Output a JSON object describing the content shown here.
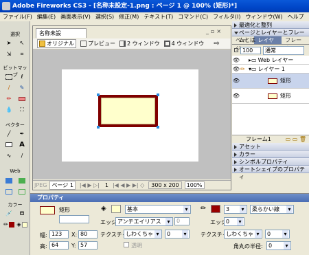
{
  "window": {
    "title": "Adobe Fireworks CS3 - [名称未設定-1.png : ページ 1 @ 100% (矩形)*]"
  },
  "menu": [
    "ファイル(F)",
    "編集(E)",
    "画面表示(V)",
    "選択(S)",
    "修正(M)",
    "テキスト(T)",
    "コマンド(C)",
    "フィルタ(I)",
    "ウィンドウ(W)",
    "ヘルプ(H)"
  ],
  "tools": {
    "select": "選択",
    "bitmap": "ビットマップ",
    "vector": "ベクター",
    "web": "Web",
    "colors": "カラー"
  },
  "document": {
    "tab": "名称未設定-1.png*",
    "views": [
      "オリジナル",
      "プレビュー",
      "2 ウィンドウ",
      "4 ウィンドウ"
    ],
    "status": {
      "format": "JPEG",
      "page": "ページ 1",
      "frame": "1",
      "size": "300 x 200",
      "zoom": "100%"
    }
  },
  "panels": {
    "align": "最適化と整列",
    "pages": "ページとレイヤーとフレームとは",
    "tabs": [
      "ページ",
      "レイヤー",
      "フレーム"
    ],
    "opacity": "100",
    "blend": "通常",
    "layers": [
      {
        "name": "Web レイヤー"
      },
      {
        "name": "レイヤー 1"
      },
      {
        "name": "矩形"
      },
      {
        "name": "矩形"
      }
    ],
    "frame": "フレーム1",
    "collapsed": [
      "アセット",
      "カラー",
      "シンボルプロパティ",
      "オートシェイプのプロパティ"
    ]
  },
  "properties": {
    "header": "プロパティ",
    "object": "矩形",
    "w_label": "幅:",
    "w": "123",
    "h_label": "高:",
    "h": "64",
    "x_label": "X:",
    "x": "80",
    "y_label": "Y:",
    "y": "57",
    "fill_type": "基本",
    "edge_label": "エッジ:",
    "edge": "アンチエイリアス",
    "edge_amount": "0",
    "texture_label": "テクスチャ:",
    "texture": "しわくちゃ",
    "texture_amount": "0",
    "transparent": "透明",
    "stroke_size": "3",
    "stroke_type": "柔らかい線",
    "stroke_edge_label": "エッジ:",
    "stroke_edge": "0",
    "stroke_texture_label": "テクスチャ:",
    "stroke_texture": "しわくちゃ",
    "stroke_texture_amount": "0",
    "radius_label": "角丸の半径:",
    "radius": "0",
    "colors": {
      "fill": "#ffffcc",
      "stroke": "#990000"
    }
  }
}
